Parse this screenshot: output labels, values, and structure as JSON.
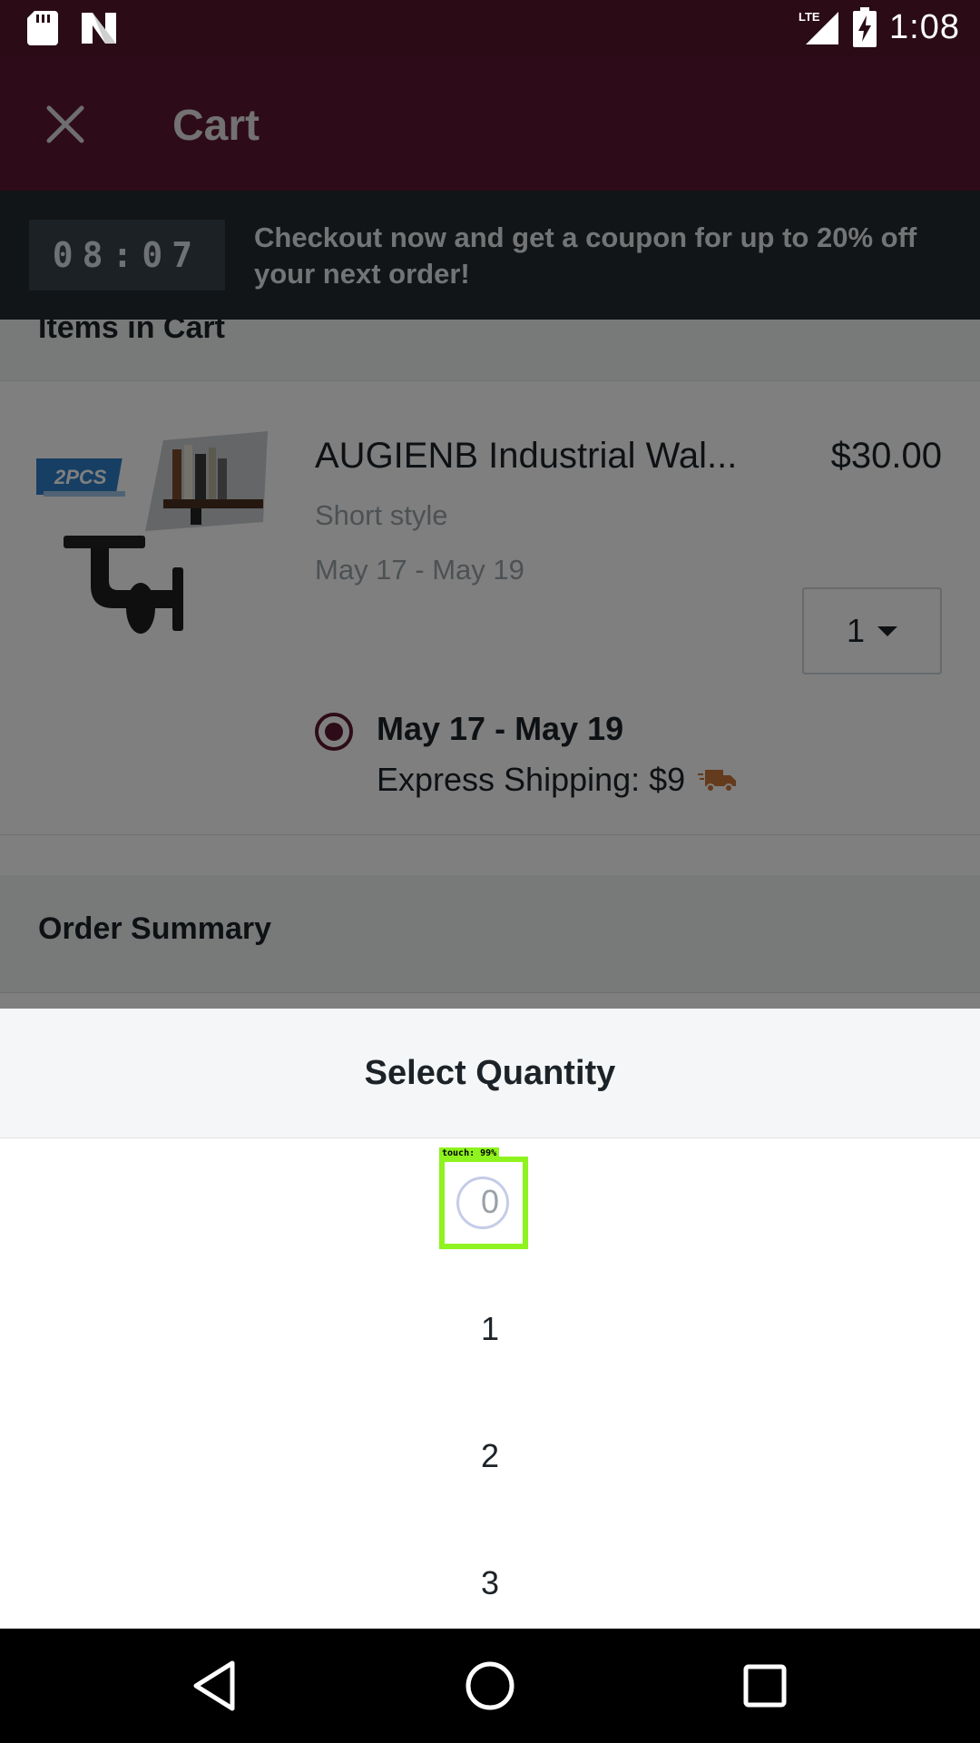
{
  "status_bar": {
    "network": "LTE",
    "time": "1:08"
  },
  "app_bar": {
    "title": "Cart"
  },
  "banner": {
    "timer": "08:07",
    "promo": "Checkout now and get a coupon for up to 20% off your next order!"
  },
  "items_section": {
    "title": "Items in Cart"
  },
  "item": {
    "name": "AUGIENB Industrial Wal...",
    "price": "$30.00",
    "style": "Short style",
    "dates": "May 17 - May 19",
    "quantity": "1",
    "image_badge": "2PCS",
    "shipping": {
      "date": "May 17 - May 19",
      "cost": "Express Shipping: $9"
    }
  },
  "summary_section": {
    "title": "Order Summary"
  },
  "quantity_sheet": {
    "title": "Select Quantity",
    "options": [
      "0",
      "1",
      "2",
      "3"
    ]
  },
  "overlay": {
    "touch_label": "touch: 99%"
  },
  "colors": {
    "accent": "#5a1630",
    "touch_highlight": "#8ef31e"
  }
}
